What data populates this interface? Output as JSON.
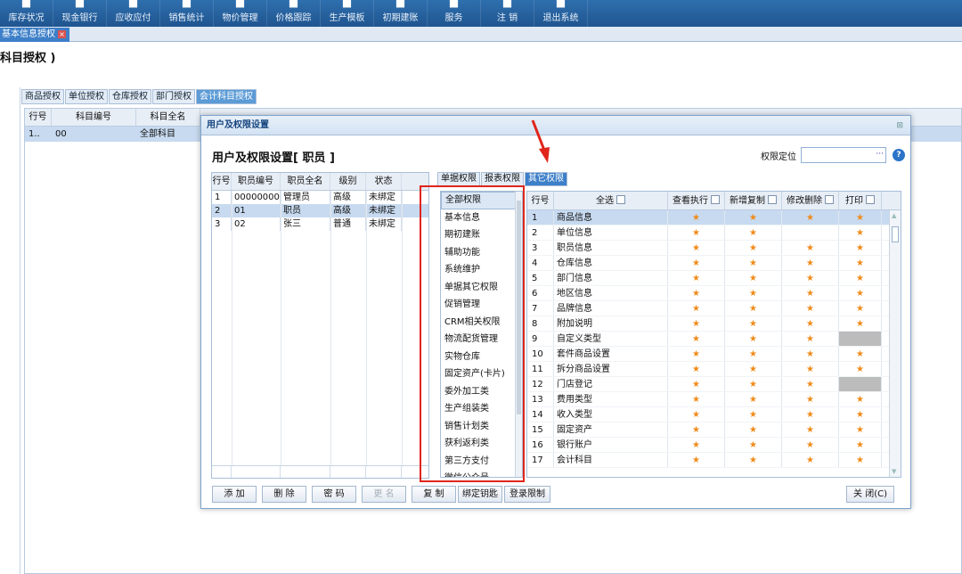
{
  "topnav": {
    "items": [
      {
        "label": "库存状况",
        "icon": "home-icon"
      },
      {
        "label": "现金银行",
        "icon": "cash-icon"
      },
      {
        "label": "应收应付",
        "icon": "receivable-icon"
      },
      {
        "label": "销售统计",
        "icon": "stats-icon"
      },
      {
        "label": "物价管理",
        "icon": "price-icon"
      },
      {
        "label": "价格跟踪",
        "icon": "tracking-icon"
      },
      {
        "label": "生产模板",
        "icon": "template-icon"
      },
      {
        "label": "初期建账",
        "icon": "ledger-icon"
      },
      {
        "label": "服务",
        "icon": "help-icon"
      },
      {
        "label": "注 销",
        "icon": "logout-icon"
      },
      {
        "label": "退出系统",
        "icon": "exit-icon"
      }
    ]
  },
  "page_tab": {
    "label": "基本信息授权",
    "close": "×"
  },
  "page_title": "科目授权 )",
  "auth_tabs": [
    "商品授权",
    "单位授权",
    "仓库授权",
    "部门授权",
    "会计科目授权"
  ],
  "bg_grid": {
    "headers": [
      "行号",
      "科目编号",
      "科目全名"
    ],
    "row": [
      "1..",
      "00",
      "全部科目"
    ]
  },
  "dialog": {
    "title": "用户及权限设置",
    "close": "⊠",
    "heading": "用户及权限设置[ 职员 ]",
    "locate_label": "权限定位",
    "locate_button": "···",
    "help": "?",
    "user_grid": {
      "headers": [
        "行号",
        "职员编号",
        "职员全名",
        "级别",
        "状态"
      ],
      "rows": [
        [
          "1",
          "00000000",
          "管理员",
          "高级",
          "未绑定"
        ],
        [
          "2",
          "01",
          "职员",
          "高级",
          "未绑定"
        ],
        [
          "3",
          "02",
          "张三",
          "普通",
          "未绑定"
        ]
      ]
    },
    "perm_tabs": [
      "单据权限",
      "报表权限",
      "其它权限"
    ],
    "categories": [
      "全部权限",
      "基本信息",
      "期初建账",
      "辅助功能",
      "系统维护",
      "单据其它权限",
      "促销管理",
      "CRM相关权限",
      "物流配货管理",
      "实物仓库",
      "固定资产(卡片)",
      "委外加工类",
      "生产组装类",
      "销售计划类",
      "获利返利类",
      "第三方支付",
      "微信公众号"
    ],
    "perm_grid": {
      "headers": [
        "行号",
        "全选",
        "查看执行",
        "新增复制",
        "修改删除",
        "打印"
      ],
      "star": "★",
      "rows": [
        {
          "n": "1",
          "name": "商品信息",
          "cols": [
            "star",
            "star",
            "star",
            "star"
          ]
        },
        {
          "n": "2",
          "name": "单位信息",
          "cols": [
            "star",
            "star",
            "",
            "star"
          ]
        },
        {
          "n": "3",
          "name": "职员信息",
          "cols": [
            "star",
            "star",
            "star",
            "star"
          ]
        },
        {
          "n": "4",
          "name": "仓库信息",
          "cols": [
            "star",
            "star",
            "star",
            "star"
          ]
        },
        {
          "n": "5",
          "name": "部门信息",
          "cols": [
            "star",
            "star",
            "star",
            "star"
          ]
        },
        {
          "n": "6",
          "name": "地区信息",
          "cols": [
            "star",
            "star",
            "star",
            "star"
          ]
        },
        {
          "n": "7",
          "name": "品牌信息",
          "cols": [
            "star",
            "star",
            "star",
            "star"
          ]
        },
        {
          "n": "8",
          "name": "附加说明",
          "cols": [
            "star",
            "star",
            "star",
            "star"
          ]
        },
        {
          "n": "9",
          "name": "自定义类型",
          "cols": [
            "star",
            "star",
            "star",
            "gray"
          ]
        },
        {
          "n": "10",
          "name": "套件商品设置",
          "cols": [
            "star",
            "star",
            "star",
            "star"
          ]
        },
        {
          "n": "11",
          "name": "拆分商品设置",
          "cols": [
            "star",
            "star",
            "star",
            "star"
          ]
        },
        {
          "n": "12",
          "name": "门店登记",
          "cols": [
            "star",
            "star",
            "star",
            "gray"
          ]
        },
        {
          "n": "13",
          "name": "费用类型",
          "cols": [
            "star",
            "star",
            "star",
            "star"
          ]
        },
        {
          "n": "14",
          "name": "收入类型",
          "cols": [
            "star",
            "star",
            "star",
            "star"
          ]
        },
        {
          "n": "15",
          "name": "固定资产",
          "cols": [
            "star",
            "star",
            "star",
            "star"
          ]
        },
        {
          "n": "16",
          "name": "银行账户",
          "cols": [
            "star",
            "star",
            "star",
            "star"
          ]
        },
        {
          "n": "17",
          "name": "会计科目",
          "cols": [
            "star",
            "star",
            "star",
            "star"
          ]
        }
      ]
    },
    "buttons": {
      "add": "添 加",
      "delete": "删 除",
      "password": "密 码",
      "rename": "更 名",
      "copy": "复 制",
      "bind_key": "绑定钥匙",
      "login_limit": "登录限制",
      "close": "关 闭(C)"
    }
  },
  "colors": {
    "nav_bg": "#1f5590",
    "highlight": "#e0251b",
    "selected_row": "#c7daf0",
    "star": "#f08a18"
  }
}
